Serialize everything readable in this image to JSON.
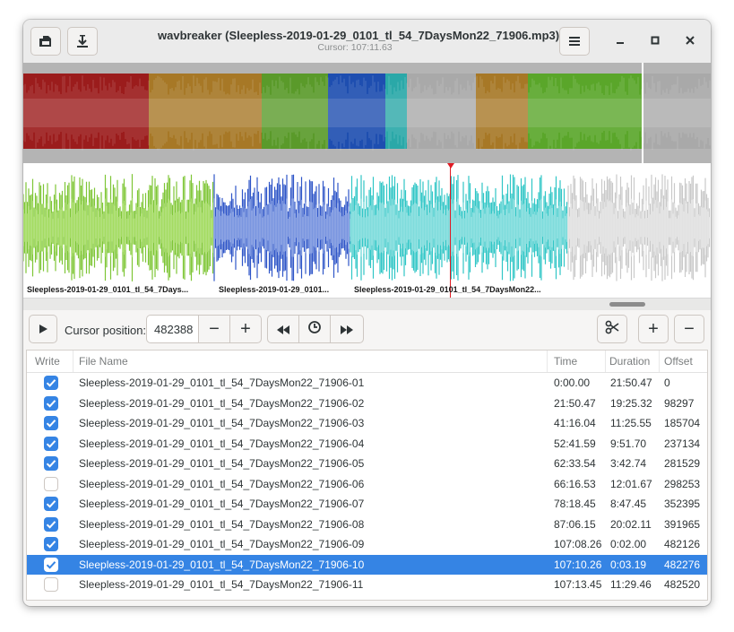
{
  "window": {
    "title": "wavbreaker (Sleepless-2019-01-29_0101_tl_54_7DaysMon22_71906.mp3)",
    "subtitle": "Cursor: 107:11.63"
  },
  "header": {
    "icons": [
      "open-file-icon",
      "save-download-icon",
      "menu-icon",
      "minimize-icon",
      "maximize-icon",
      "close-icon"
    ]
  },
  "waveform": {
    "overview_colors": [
      "#9b1c1c",
      "#a77826",
      "#5a9a2a",
      "#1e4eb0",
      "#2aa8a8",
      "#a77826",
      "#5aa62a"
    ],
    "zoom_labels": [
      "Sleepless-2019-01-29_0101_tl_54_7Days...",
      "Sleepless-2019-01-29_0101...",
      "Sleepless-2019-01-29_0101_tl_54_7DaysMon22..."
    ]
  },
  "toolbar": {
    "play_icon": "play-icon",
    "cursor_label": "Cursor position:",
    "cursor_value": "482388",
    "minus": "−",
    "plus": "+",
    "buttons": [
      "jump-back-icon",
      "jump-to-cursor-icon",
      "jump-forward-icon",
      "split-scissors-icon",
      "add-break-button",
      "remove-break-button"
    ]
  },
  "table": {
    "columns": [
      "Write",
      "File Name",
      "Time",
      "Duration",
      "Offset"
    ],
    "rows": [
      {
        "write": true,
        "name": "Sleepless-2019-01-29_0101_tl_54_7DaysMon22_71906-01",
        "time": "0:00.00",
        "duration": "21:50.47",
        "offset": "0"
      },
      {
        "write": true,
        "name": "Sleepless-2019-01-29_0101_tl_54_7DaysMon22_71906-02",
        "time": "21:50.47",
        "duration": "19:25.32",
        "offset": "98297"
      },
      {
        "write": true,
        "name": "Sleepless-2019-01-29_0101_tl_54_7DaysMon22_71906-03",
        "time": "41:16.04",
        "duration": "11:25.55",
        "offset": "185704"
      },
      {
        "write": true,
        "name": "Sleepless-2019-01-29_0101_tl_54_7DaysMon22_71906-04",
        "time": "52:41.59",
        "duration": "9:51.70",
        "offset": "237134"
      },
      {
        "write": true,
        "name": "Sleepless-2019-01-29_0101_tl_54_7DaysMon22_71906-05",
        "time": "62:33.54",
        "duration": "3:42.74",
        "offset": "281529"
      },
      {
        "write": false,
        "name": "Sleepless-2019-01-29_0101_tl_54_7DaysMon22_71906-06",
        "time": "66:16.53",
        "duration": "12:01.67",
        "offset": "298253"
      },
      {
        "write": true,
        "name": "Sleepless-2019-01-29_0101_tl_54_7DaysMon22_71906-07",
        "time": "78:18.45",
        "duration": "8:47.45",
        "offset": "352395"
      },
      {
        "write": true,
        "name": "Sleepless-2019-01-29_0101_tl_54_7DaysMon22_71906-08",
        "time": "87:06.15",
        "duration": "20:02.11",
        "offset": "391965"
      },
      {
        "write": true,
        "name": "Sleepless-2019-01-29_0101_tl_54_7DaysMon22_71906-09",
        "time": "107:08.26",
        "duration": "0:02.00",
        "offset": "482126"
      },
      {
        "write": true,
        "name": "Sleepless-2019-01-29_0101_tl_54_7DaysMon22_71906-10",
        "time": "107:10.26",
        "duration": "0:03.19",
        "offset": "482276",
        "selected": true
      },
      {
        "write": false,
        "name": "Sleepless-2019-01-29_0101_tl_54_7DaysMon22_71906-11",
        "time": "107:13.45",
        "duration": "11:29.46",
        "offset": "482520"
      }
    ]
  }
}
